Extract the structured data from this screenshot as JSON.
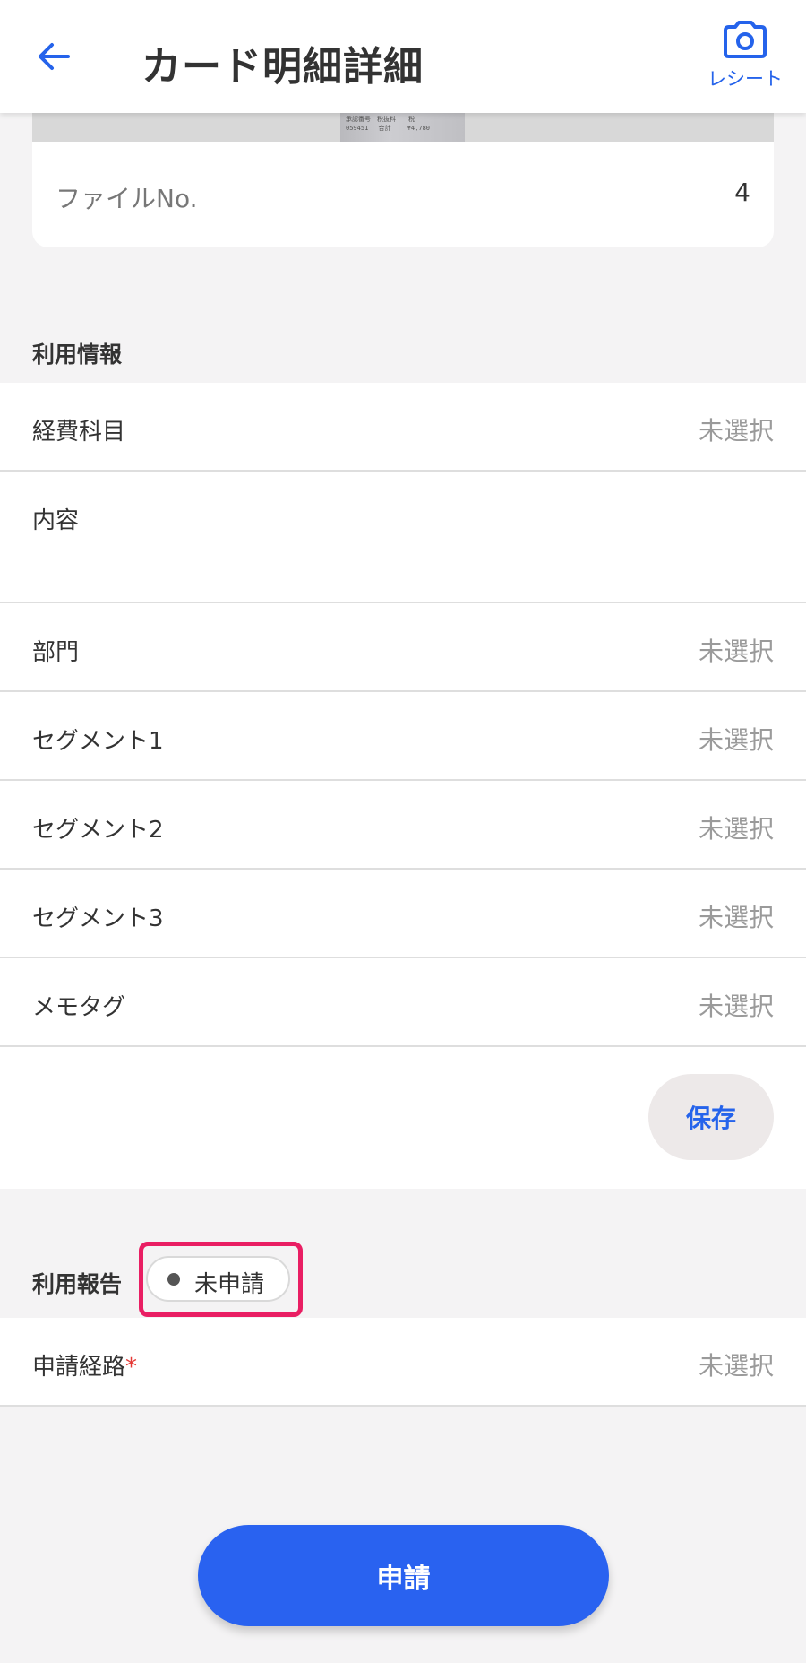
{
  "header": {
    "title": "カード明細詳細",
    "receipt_label": "レシート"
  },
  "file": {
    "label": "ファイルNo.",
    "value": "4"
  },
  "usage_info": {
    "title": "利用情報",
    "rows": [
      {
        "label": "経費科目",
        "value": "未選択"
      },
      {
        "label": "内容",
        "value": ""
      },
      {
        "label": "部門",
        "value": "未選択"
      },
      {
        "label": "セグメント1",
        "value": "未選択"
      },
      {
        "label": "セグメント2",
        "value": "未選択"
      },
      {
        "label": "セグメント3",
        "value": "未選択"
      },
      {
        "label": "メモタグ",
        "value": "未選択"
      }
    ],
    "save_label": "保存"
  },
  "usage_report": {
    "title": "利用報告",
    "status": "未申請",
    "route_label": "申請経路",
    "required_mark": "*",
    "route_value": "未選択"
  },
  "submit_label": "申請",
  "colors": {
    "accent": "#2563eb",
    "highlight": "#e91e63",
    "required": "#e53935"
  }
}
